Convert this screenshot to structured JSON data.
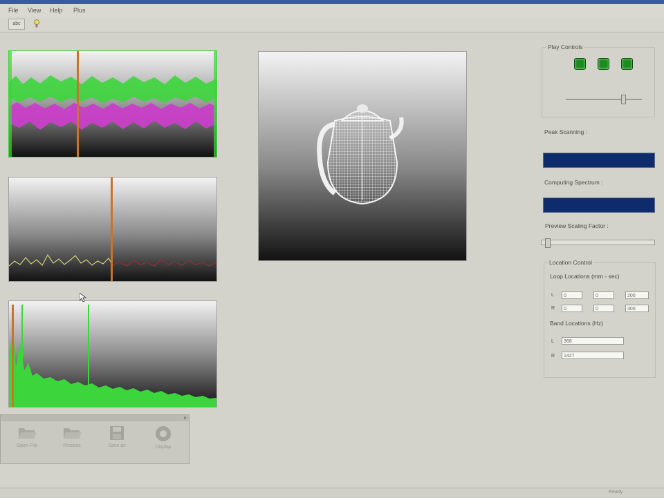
{
  "menu": {
    "items": [
      "File",
      "View",
      "Help",
      "Plus"
    ]
  },
  "toolbar": {
    "button1": "abc"
  },
  "play_controls": {
    "title": "Play Controls"
  },
  "peak_scanning": {
    "label": "Peak Scanning :"
  },
  "computing_spectrum": {
    "label": "Computing Spectrum :"
  },
  "preview_scaling": {
    "label": "Preview Scaling Factor :"
  },
  "location_control": {
    "title": "Location Control",
    "loop_label": "Loop Locations (mm - sec)",
    "row_l_label": "L",
    "row_r_label": "R",
    "l_values": [
      "0",
      "0",
      "200"
    ],
    "r_values": [
      "0",
      "0",
      "300"
    ],
    "band_label": "Band Locations (Hz)",
    "band_l_label": "L",
    "band_r_label": "R",
    "band_l_value": "368",
    "band_r_value": "1427"
  },
  "floating_toolbar": {
    "buttons": [
      {
        "label": "Open File",
        "icon": "folder-open-icon"
      },
      {
        "label": "Process",
        "icon": "folder-icon"
      },
      {
        "label": "Save as",
        "icon": "save-icon"
      },
      {
        "label": "Display",
        "icon": "disc-icon"
      }
    ]
  },
  "statusbar": {
    "right_text": "Ready"
  },
  "colors": {
    "background": "#d3d3cb",
    "progress_blue": "#0e2c6c",
    "waveform_green": "#3cd63c",
    "waveform_magenta": "#c93fc9",
    "cursor_orange": "#c8742a"
  }
}
